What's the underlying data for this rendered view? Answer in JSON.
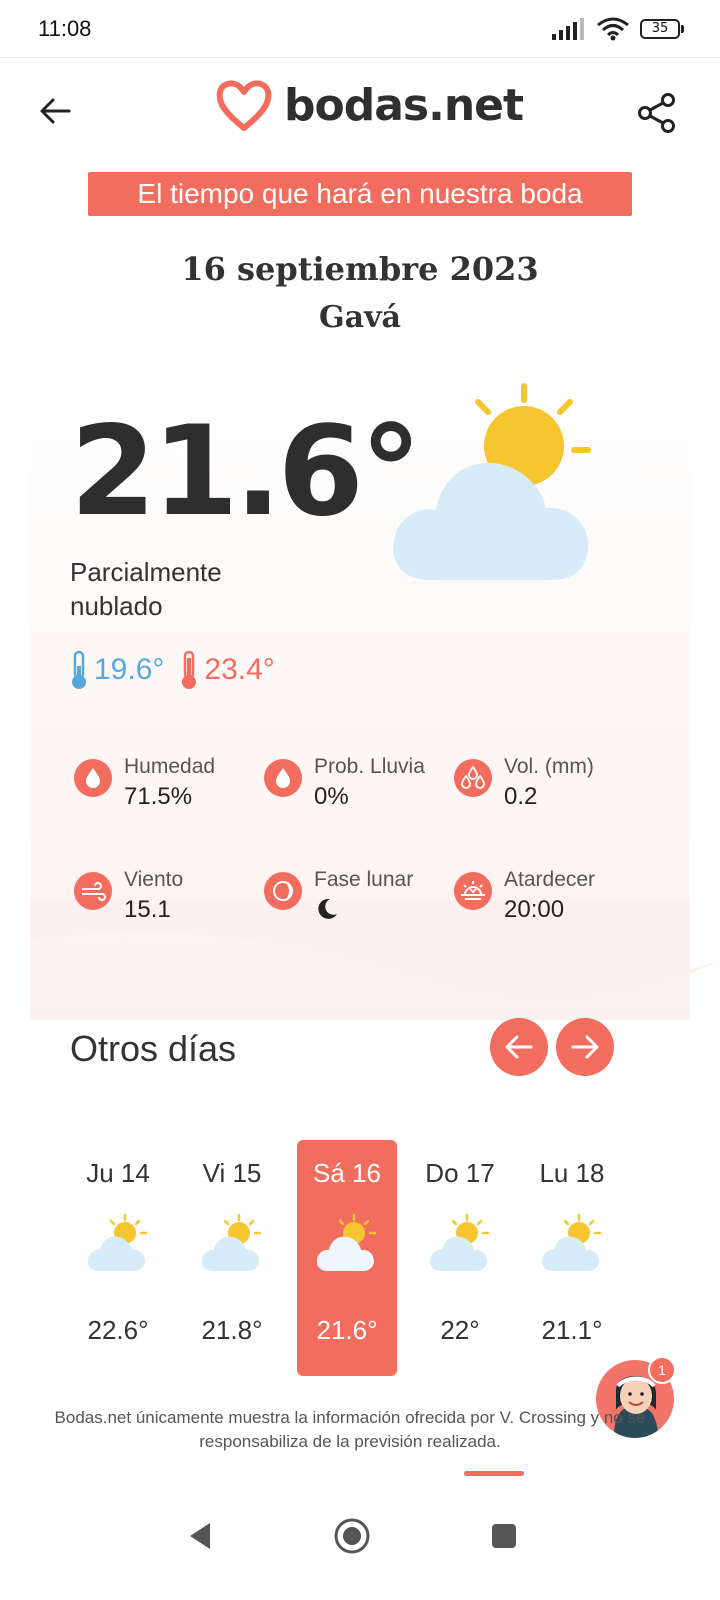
{
  "status_bar": {
    "time": "11:08",
    "battery": "35"
  },
  "header": {
    "logo_text": "bodas.net",
    "back_icon": "arrow-left-icon",
    "share_icon": "share-icon"
  },
  "banner": "El tiempo que hará en nuestra boda",
  "date": "16 septiembre 2023",
  "place": "Gavá",
  "current": {
    "temperature": "21.6°",
    "condition": "Parcialmente nublado",
    "min": "19.6°",
    "max": "23.4°",
    "icon": "partly-cloudy-icon"
  },
  "stats": [
    {
      "label": "Humedad",
      "value": "71.5%",
      "icon": "drop-icon"
    },
    {
      "label": "Prob. Lluvia",
      "value": "0%",
      "icon": "drop-icon"
    },
    {
      "label": "Vol. (mm)",
      "value": "0.2",
      "icon": "drops-icon"
    },
    {
      "label": "Viento",
      "value": "15.1",
      "icon": "wind-icon"
    },
    {
      "label": "Fase lunar",
      "value": "",
      "icon": "moon-phase-icon"
    },
    {
      "label": "Atardecer",
      "value": "20:00",
      "icon": "sunset-icon"
    }
  ],
  "other_days": {
    "title": "Otros días",
    "days": [
      {
        "name": "Ju 14",
        "temp": "22.6°"
      },
      {
        "name": "Vi 15",
        "temp": "21.8°"
      },
      {
        "name": "Sá 16",
        "temp": "21.6°"
      },
      {
        "name": "Do 17",
        "temp": "22°"
      },
      {
        "name": "Lu 18",
        "temp": "21.1°"
      }
    ],
    "selected_index": 2
  },
  "chat": {
    "badge": "1"
  },
  "disclaimer": "Bodas.net únicamente muestra la información ofrecida por V. Crossing y no se responsabiliza de la previsión realizada.",
  "colors": {
    "accent": "#f26d5e",
    "min_blue": "#58a8e0",
    "sun": "#f7c52f",
    "cloud": "#d6ecf8"
  }
}
